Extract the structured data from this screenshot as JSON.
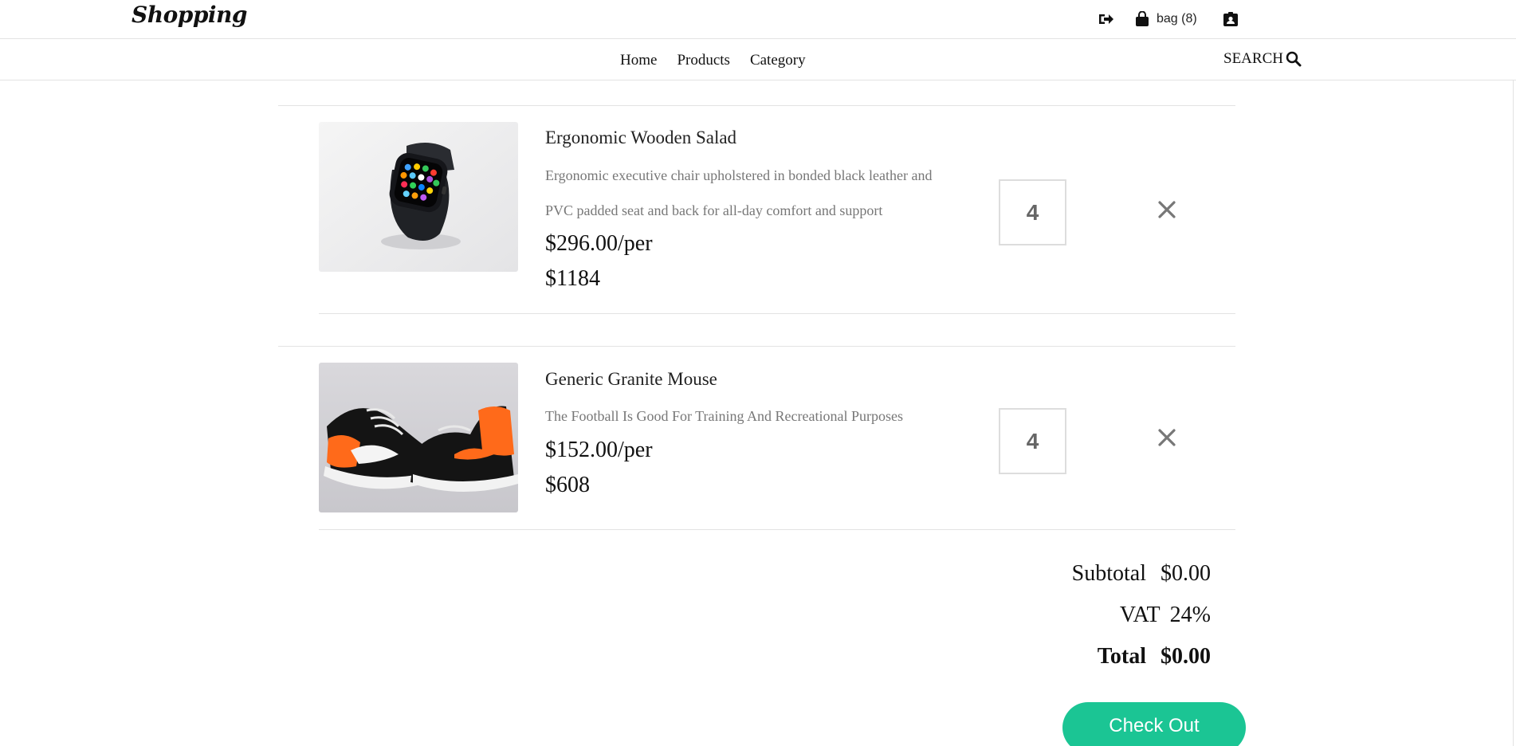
{
  "header": {
    "logo": "Shopping",
    "bag_label": "bag (8)",
    "icons": [
      "sign-out-icon",
      "shopping-bag-icon",
      "id-badge-icon"
    ]
  },
  "nav": {
    "links": [
      "Home",
      "Products",
      "Category"
    ],
    "search_label": "SEARCH",
    "search_icon": "search-icon"
  },
  "cart": {
    "items": [
      {
        "name": "Ergonomic Wooden Salad",
        "description": "Ergonomic executive chair upholstered in bonded black leather and PVC padded seat and back for all-day comfort and support",
        "unit_price": "$296.00/per",
        "line_total": "$1184",
        "quantity": "4",
        "image": "smartwatch photo"
      },
      {
        "name": "Generic Granite Mouse",
        "description": "The Football Is Good For Training And Recreational Purposes",
        "unit_price": "$152.00/per",
        "line_total": "$608",
        "quantity": "4",
        "image": "orange and black sneakers photo"
      }
    ],
    "remove_icon": "close-icon"
  },
  "summary": {
    "subtotal_label": "Subtotal",
    "subtotal_value": "$0.00",
    "vat_label": "VAT",
    "vat_value": "24%",
    "total_label": "Total",
    "total_value": "$0.00",
    "checkout_label": "Check Out"
  },
  "colors": {
    "accent": "#1bc594",
    "muted_text": "#777777",
    "divider": "#e3e3e3"
  }
}
